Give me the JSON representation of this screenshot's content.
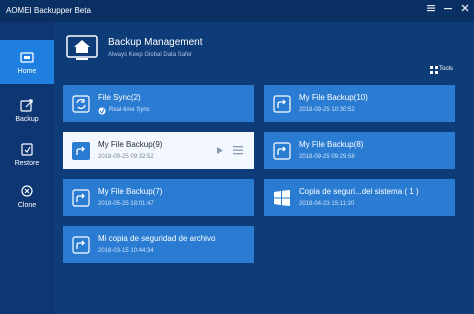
{
  "window": {
    "title": "AOMEI Backupper Beta",
    "icons": [
      "menu-icon",
      "minimize-icon",
      "close-icon"
    ]
  },
  "sidebar": {
    "items": [
      {
        "label": "Home",
        "icon": "home-icon",
        "active": true
      },
      {
        "label": "Backup",
        "icon": "backup-icon",
        "active": false
      },
      {
        "label": "Restore",
        "icon": "restore-icon",
        "active": false
      },
      {
        "label": "Clone",
        "icon": "clone-icon",
        "active": false
      }
    ]
  },
  "header": {
    "title": "Backup Management",
    "subtitle": "Always Keep Global Data Safer",
    "tools_label": "Tools"
  },
  "cards": [
    {
      "title": "File Sync(2)",
      "subtitle": "Real-time Sync",
      "icon": "sync-icon"
    },
    {
      "title": "My File Backup(10)",
      "date": "2018-09-25 10:30:52",
      "icon": "backup-arrow-icon"
    },
    {
      "title": "My File Backup(9)",
      "date": "2018-09-25 09:32:52",
      "icon": "backup-arrow-icon",
      "selected": true
    },
    {
      "title": "My File Backup(8)",
      "date": "2018-09-25 09:29:58",
      "icon": "backup-arrow-icon"
    },
    {
      "title": "My File Backup(7)",
      "date": "2018-05-25 18:01:47",
      "icon": "backup-arrow-icon"
    },
    {
      "title": "Copia de seguri...del sistema ( 1 )",
      "date": "2018-04-23 15:11:20",
      "icon": "windows-icon"
    },
    {
      "title": "Mi copia de seguridad de archivo",
      "date": "2018-03-15 10:44:34",
      "icon": "backup-arrow-icon"
    }
  ],
  "colors": {
    "background": "#0e3c78",
    "sidebar": "#0d3673",
    "active_nav": "#1e7fe0",
    "card": "#2a7cd3",
    "card_selected": "#f3f8fe"
  }
}
